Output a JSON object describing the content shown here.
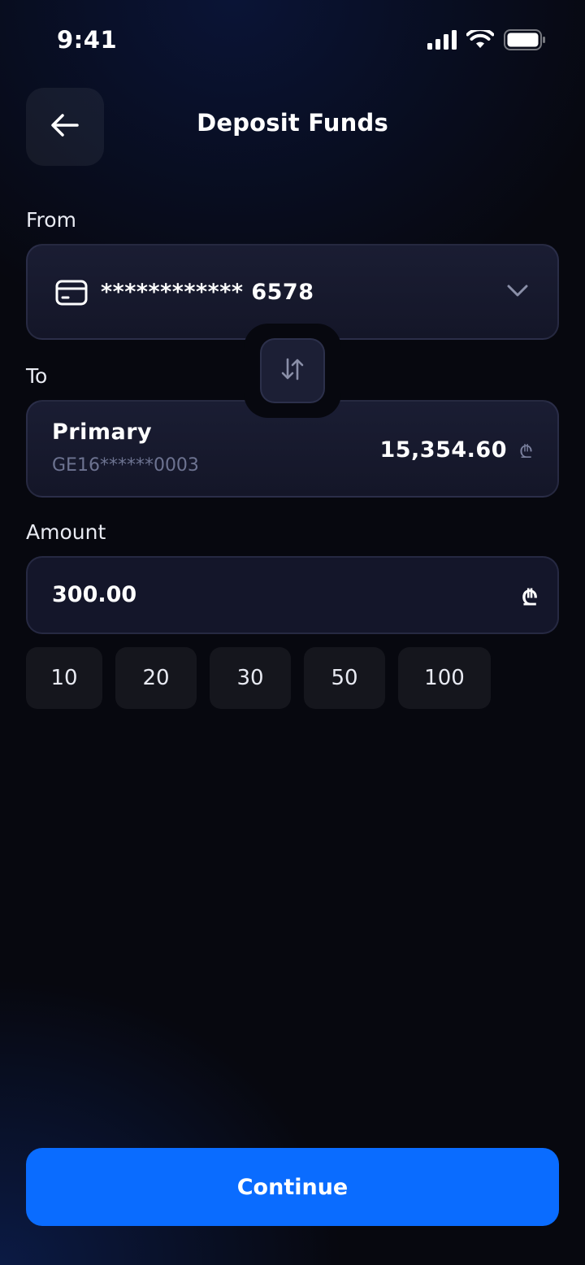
{
  "status_bar": {
    "time": "9:41",
    "icons": [
      "cellular-signal-icon",
      "wifi-icon",
      "battery-icon"
    ]
  },
  "header": {
    "title": "Deposit Funds",
    "back_icon": "arrow-left-icon"
  },
  "from": {
    "label": "From",
    "card_icon": "credit-card-icon",
    "card_number": "************ 6578",
    "chevron_icon": "chevron-down-icon"
  },
  "swap": {
    "icon": "swap-vertical-arrows-icon"
  },
  "to": {
    "label": "To",
    "account_name": "Primary",
    "account_iban": "GE16******0003",
    "balance": "15,354.60",
    "currency": "₾"
  },
  "amount": {
    "label": "Amount",
    "value": "300.00",
    "currency": "₾"
  },
  "quick_amounts": [
    "10",
    "20",
    "30",
    "50",
    "100"
  ],
  "continue_label": "Continue",
  "colors": {
    "accent": "#0a6cff",
    "background": "#07080f",
    "card": "#171a2e",
    "muted_text": "#6d7391"
  }
}
